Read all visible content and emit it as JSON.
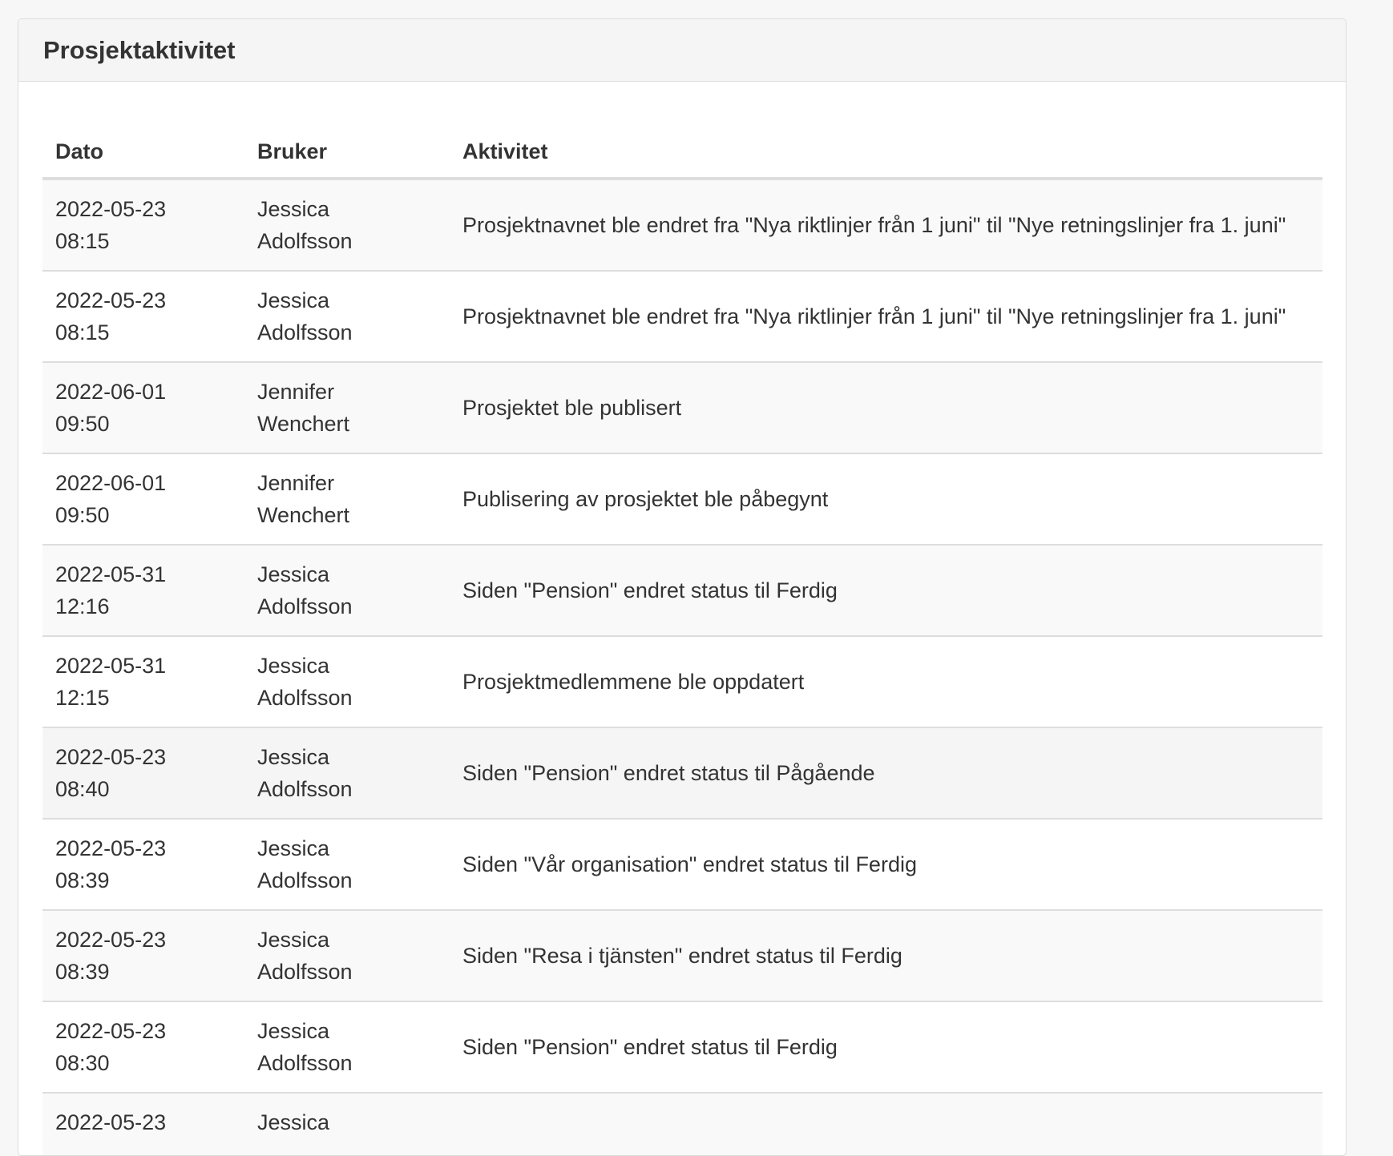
{
  "panel": {
    "title": "Prosjektaktivitet"
  },
  "table": {
    "headers": {
      "date": "Dato",
      "user": "Bruker",
      "activity": "Aktivitet"
    },
    "rows": [
      {
        "date": "2022-05-23",
        "time": "08:15",
        "first": "Jessica",
        "last": "Adolfsson",
        "activity": "Prosjektnavnet ble endret fra \"Nya riktlinjer från 1 juni\" til \"Nye retningslinjer fra 1. juni\""
      },
      {
        "date": "2022-05-23",
        "time": "08:15",
        "first": "Jessica",
        "last": "Adolfsson",
        "activity": "Prosjektnavnet ble endret fra \"Nya riktlinjer från 1 juni\" til \"Nye retningslinjer fra 1. juni\""
      },
      {
        "date": "2022-06-01",
        "time": "09:50",
        "first": "Jennifer",
        "last": "Wenchert",
        "activity": "Prosjektet ble publisert"
      },
      {
        "date": "2022-06-01",
        "time": "09:50",
        "first": "Jennifer",
        "last": "Wenchert",
        "activity": "Publisering av prosjektet ble påbegynt"
      },
      {
        "date": "2022-05-31",
        "time": "12:16",
        "first": "Jessica",
        "last": "Adolfsson",
        "activity": "Siden \"Pension\" endret status til Ferdig"
      },
      {
        "date": "2022-05-31",
        "time": "12:15",
        "first": "Jessica",
        "last": "Adolfsson",
        "activity": "Prosjektmedlemmene ble oppdatert"
      },
      {
        "date": "2022-05-23",
        "time": "08:40",
        "first": "Jessica",
        "last": "Adolfsson",
        "activity": "Siden \"Pension\" endret status til Pågående"
      },
      {
        "date": "2022-05-23",
        "time": "08:39",
        "first": "Jessica",
        "last": "Adolfsson",
        "activity": "Siden \"Vår organisation\" endret status til Ferdig"
      },
      {
        "date": "2022-05-23",
        "time": "08:39",
        "first": "Jessica",
        "last": "Adolfsson",
        "activity": "Siden \"Resa i tjänsten\" endret status til Ferdig"
      },
      {
        "date": "2022-05-23",
        "time": "08:30",
        "first": "Jessica",
        "last": "Adolfsson",
        "activity": "Siden \"Pension\" endret status til Ferdig"
      },
      {
        "date": "2022-05-23",
        "time": "",
        "first": "Jessica",
        "last": "",
        "activity": ""
      }
    ]
  }
}
